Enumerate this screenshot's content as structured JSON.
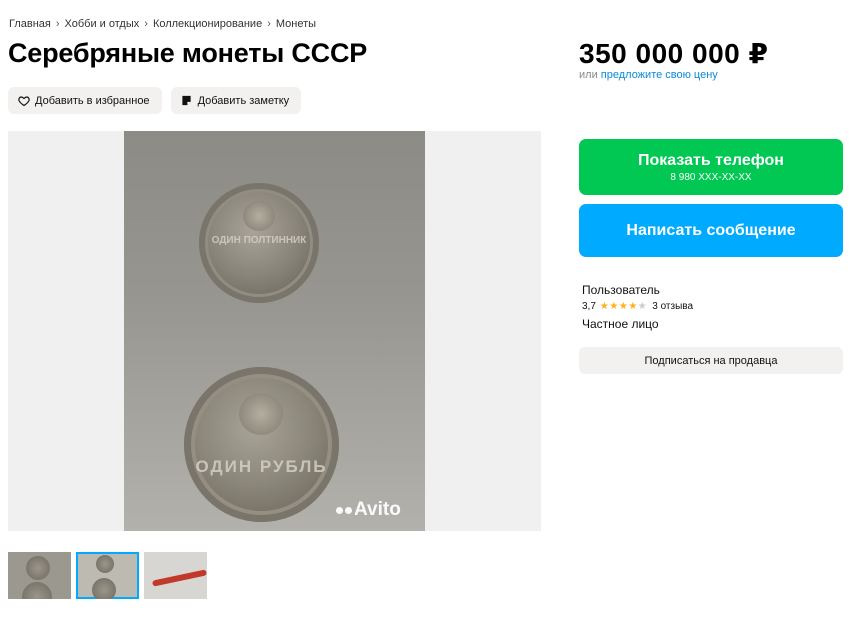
{
  "breadcrumb": [
    "Главная",
    "Хобби и отдых",
    "Коллекционирование",
    "Монеты"
  ],
  "title": "Серебряные монеты СССР",
  "actions": {
    "favorite_label": "Добавить в избранное",
    "note_label": "Добавить заметку"
  },
  "gallery": {
    "watermark": "Avito",
    "coin1_text": "ОДИН ПОЛТИННИК",
    "coin2_text": "ОДИН РУБЛЬ",
    "thumbnail_count": 3,
    "active_thumbnail": 2
  },
  "price": {
    "amount": "350 000 000 ₽",
    "offer_prefix": "или",
    "offer_link": "предложите свою цену"
  },
  "contact": {
    "phone_label": "Показать телефон",
    "phone_number": "8 980 XXX-XX-XX",
    "message_label": "Написать сообщение"
  },
  "seller": {
    "name": "Пользователь",
    "rating": "3,7",
    "rating_value": 3.7,
    "reviews": "3 отзыва",
    "type": "Частное лицо",
    "subscribe_label": "Подписаться на продавца"
  },
  "colors": {
    "accent_green": "#00c853",
    "accent_blue": "#00aaff",
    "link": "#0a8bd6",
    "star": "#ffb021"
  }
}
